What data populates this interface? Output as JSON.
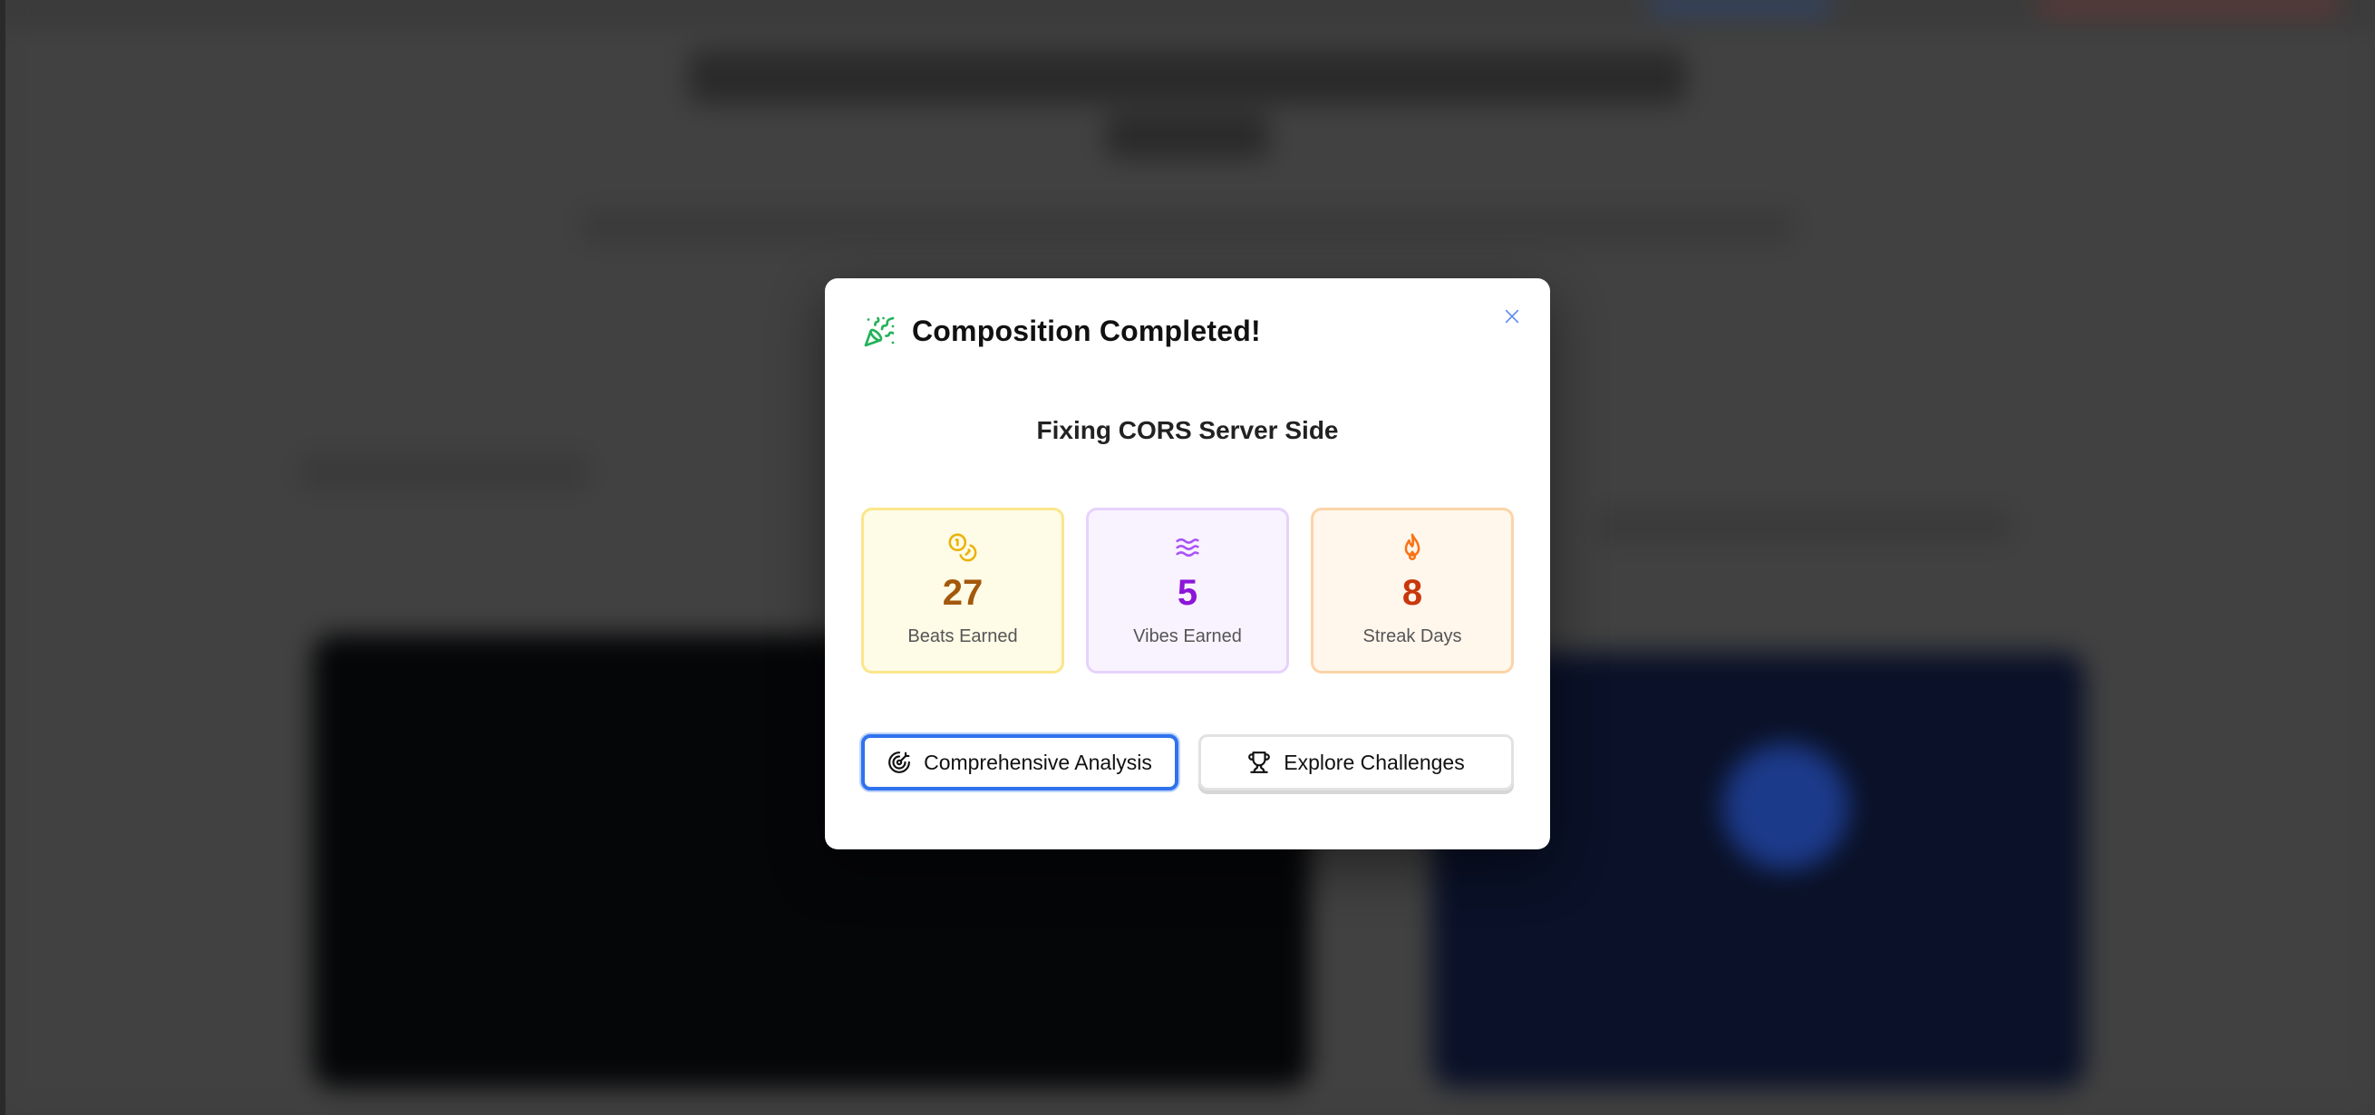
{
  "modal": {
    "title": "Composition Completed!",
    "subtitle": "Fixing CORS Server Side",
    "header_icon": "party-popper-icon",
    "close_icon": "close-icon",
    "stats": [
      {
        "value": "27",
        "label": "Beats Earned",
        "icon": "coins-icon",
        "color": "#a3580c"
      },
      {
        "value": "5",
        "label": "Vibes Earned",
        "icon": "waves-icon",
        "color": "#8c16d8"
      },
      {
        "value": "8",
        "label": "Streak Days",
        "icon": "flame-icon",
        "color": "#c8380c"
      }
    ],
    "actions": {
      "analysis_label": "Comprehensive Analysis",
      "analysis_icon": "target-icon",
      "explore_label": "Explore Challenges",
      "explore_icon": "trophy-icon"
    }
  },
  "colors": {
    "accent": "#2f72ee",
    "success": "#22b35a",
    "overlay": "#3d3d3d"
  }
}
